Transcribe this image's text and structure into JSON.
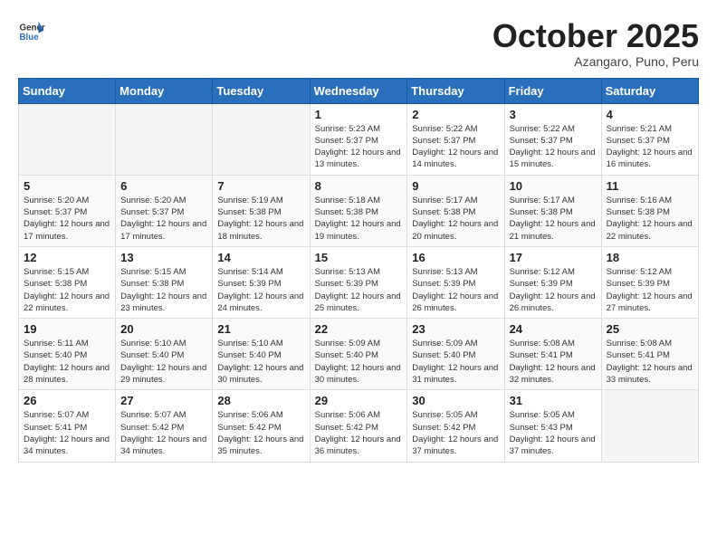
{
  "header": {
    "logo_general": "General",
    "logo_blue": "Blue",
    "month": "October 2025",
    "location": "Azangaro, Puno, Peru"
  },
  "weekdays": [
    "Sunday",
    "Monday",
    "Tuesday",
    "Wednesday",
    "Thursday",
    "Friday",
    "Saturday"
  ],
  "weeks": [
    [
      {
        "day": "",
        "sunrise": "",
        "sunset": "",
        "daylight": ""
      },
      {
        "day": "",
        "sunrise": "",
        "sunset": "",
        "daylight": ""
      },
      {
        "day": "",
        "sunrise": "",
        "sunset": "",
        "daylight": ""
      },
      {
        "day": "1",
        "sunrise": "Sunrise: 5:23 AM",
        "sunset": "Sunset: 5:37 PM",
        "daylight": "Daylight: 12 hours and 13 minutes."
      },
      {
        "day": "2",
        "sunrise": "Sunrise: 5:22 AM",
        "sunset": "Sunset: 5:37 PM",
        "daylight": "Daylight: 12 hours and 14 minutes."
      },
      {
        "day": "3",
        "sunrise": "Sunrise: 5:22 AM",
        "sunset": "Sunset: 5:37 PM",
        "daylight": "Daylight: 12 hours and 15 minutes."
      },
      {
        "day": "4",
        "sunrise": "Sunrise: 5:21 AM",
        "sunset": "Sunset: 5:37 PM",
        "daylight": "Daylight: 12 hours and 16 minutes."
      }
    ],
    [
      {
        "day": "5",
        "sunrise": "Sunrise: 5:20 AM",
        "sunset": "Sunset: 5:37 PM",
        "daylight": "Daylight: 12 hours and 17 minutes."
      },
      {
        "day": "6",
        "sunrise": "Sunrise: 5:20 AM",
        "sunset": "Sunset: 5:37 PM",
        "daylight": "Daylight: 12 hours and 17 minutes."
      },
      {
        "day": "7",
        "sunrise": "Sunrise: 5:19 AM",
        "sunset": "Sunset: 5:38 PM",
        "daylight": "Daylight: 12 hours and 18 minutes."
      },
      {
        "day": "8",
        "sunrise": "Sunrise: 5:18 AM",
        "sunset": "Sunset: 5:38 PM",
        "daylight": "Daylight: 12 hours and 19 minutes."
      },
      {
        "day": "9",
        "sunrise": "Sunrise: 5:17 AM",
        "sunset": "Sunset: 5:38 PM",
        "daylight": "Daylight: 12 hours and 20 minutes."
      },
      {
        "day": "10",
        "sunrise": "Sunrise: 5:17 AM",
        "sunset": "Sunset: 5:38 PM",
        "daylight": "Daylight: 12 hours and 21 minutes."
      },
      {
        "day": "11",
        "sunrise": "Sunrise: 5:16 AM",
        "sunset": "Sunset: 5:38 PM",
        "daylight": "Daylight: 12 hours and 22 minutes."
      }
    ],
    [
      {
        "day": "12",
        "sunrise": "Sunrise: 5:15 AM",
        "sunset": "Sunset: 5:38 PM",
        "daylight": "Daylight: 12 hours and 22 minutes."
      },
      {
        "day": "13",
        "sunrise": "Sunrise: 5:15 AM",
        "sunset": "Sunset: 5:38 PM",
        "daylight": "Daylight: 12 hours and 23 minutes."
      },
      {
        "day": "14",
        "sunrise": "Sunrise: 5:14 AM",
        "sunset": "Sunset: 5:39 PM",
        "daylight": "Daylight: 12 hours and 24 minutes."
      },
      {
        "day": "15",
        "sunrise": "Sunrise: 5:13 AM",
        "sunset": "Sunset: 5:39 PM",
        "daylight": "Daylight: 12 hours and 25 minutes."
      },
      {
        "day": "16",
        "sunrise": "Sunrise: 5:13 AM",
        "sunset": "Sunset: 5:39 PM",
        "daylight": "Daylight: 12 hours and 26 minutes."
      },
      {
        "day": "17",
        "sunrise": "Sunrise: 5:12 AM",
        "sunset": "Sunset: 5:39 PM",
        "daylight": "Daylight: 12 hours and 26 minutes."
      },
      {
        "day": "18",
        "sunrise": "Sunrise: 5:12 AM",
        "sunset": "Sunset: 5:39 PM",
        "daylight": "Daylight: 12 hours and 27 minutes."
      }
    ],
    [
      {
        "day": "19",
        "sunrise": "Sunrise: 5:11 AM",
        "sunset": "Sunset: 5:40 PM",
        "daylight": "Daylight: 12 hours and 28 minutes."
      },
      {
        "day": "20",
        "sunrise": "Sunrise: 5:10 AM",
        "sunset": "Sunset: 5:40 PM",
        "daylight": "Daylight: 12 hours and 29 minutes."
      },
      {
        "day": "21",
        "sunrise": "Sunrise: 5:10 AM",
        "sunset": "Sunset: 5:40 PM",
        "daylight": "Daylight: 12 hours and 30 minutes."
      },
      {
        "day": "22",
        "sunrise": "Sunrise: 5:09 AM",
        "sunset": "Sunset: 5:40 PM",
        "daylight": "Daylight: 12 hours and 30 minutes."
      },
      {
        "day": "23",
        "sunrise": "Sunrise: 5:09 AM",
        "sunset": "Sunset: 5:40 PM",
        "daylight": "Daylight: 12 hours and 31 minutes."
      },
      {
        "day": "24",
        "sunrise": "Sunrise: 5:08 AM",
        "sunset": "Sunset: 5:41 PM",
        "daylight": "Daylight: 12 hours and 32 minutes."
      },
      {
        "day": "25",
        "sunrise": "Sunrise: 5:08 AM",
        "sunset": "Sunset: 5:41 PM",
        "daylight": "Daylight: 12 hours and 33 minutes."
      }
    ],
    [
      {
        "day": "26",
        "sunrise": "Sunrise: 5:07 AM",
        "sunset": "Sunset: 5:41 PM",
        "daylight": "Daylight: 12 hours and 34 minutes."
      },
      {
        "day": "27",
        "sunrise": "Sunrise: 5:07 AM",
        "sunset": "Sunset: 5:42 PM",
        "daylight": "Daylight: 12 hours and 34 minutes."
      },
      {
        "day": "28",
        "sunrise": "Sunrise: 5:06 AM",
        "sunset": "Sunset: 5:42 PM",
        "daylight": "Daylight: 12 hours and 35 minutes."
      },
      {
        "day": "29",
        "sunrise": "Sunrise: 5:06 AM",
        "sunset": "Sunset: 5:42 PM",
        "daylight": "Daylight: 12 hours and 36 minutes."
      },
      {
        "day": "30",
        "sunrise": "Sunrise: 5:05 AM",
        "sunset": "Sunset: 5:42 PM",
        "daylight": "Daylight: 12 hours and 37 minutes."
      },
      {
        "day": "31",
        "sunrise": "Sunrise: 5:05 AM",
        "sunset": "Sunset: 5:43 PM",
        "daylight": "Daylight: 12 hours and 37 minutes."
      },
      {
        "day": "",
        "sunrise": "",
        "sunset": "",
        "daylight": ""
      }
    ]
  ]
}
